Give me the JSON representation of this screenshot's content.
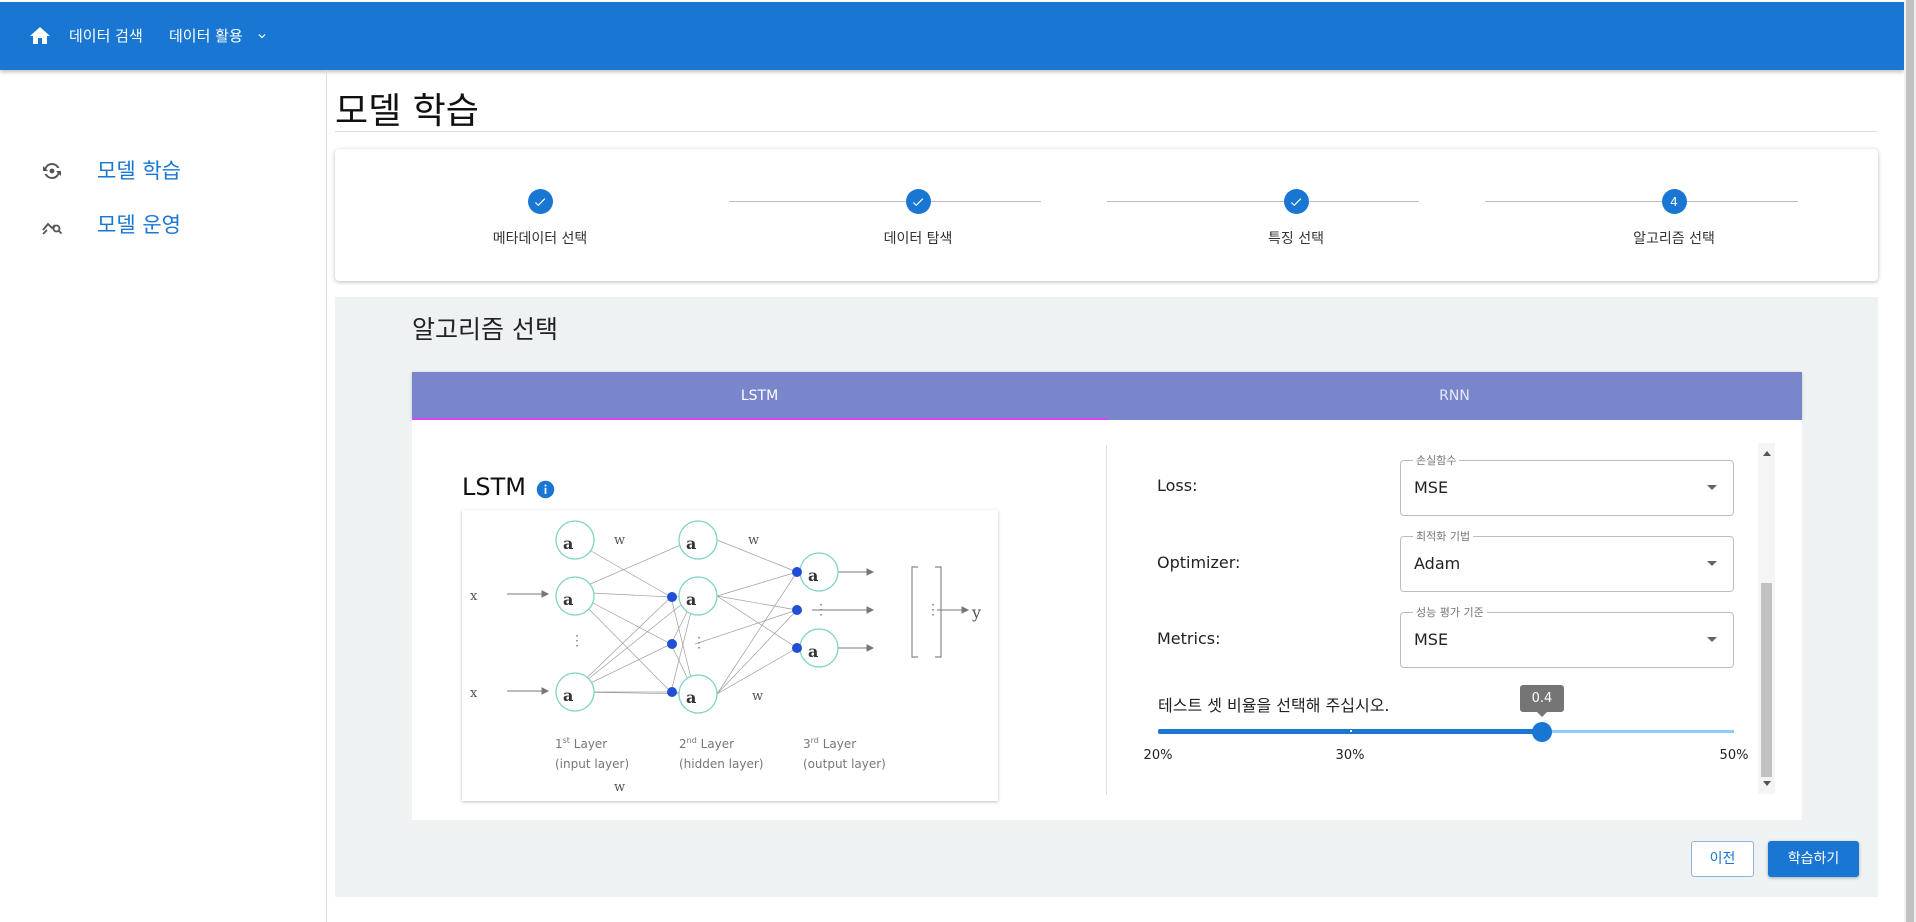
{
  "header": {
    "nav_search": "데이터 검색",
    "nav_use": "데이터 활용",
    "home_icon": "home-icon",
    "dropdown_icon": "chevron-down-icon",
    "color": "#1976d2"
  },
  "sidebar": {
    "items": [
      {
        "label": "모델 학습",
        "icon": "model-training-icon"
      },
      {
        "label": "모델 운영",
        "icon": "query-stats-icon"
      }
    ]
  },
  "page": {
    "title": "모델 학습"
  },
  "stepper": {
    "steps": [
      {
        "label": "메타데이터 선택",
        "state": "completed"
      },
      {
        "label": "데이터 탐색",
        "state": "completed"
      },
      {
        "label": "특징 선택",
        "state": "completed"
      },
      {
        "label": "알고리즘 선택",
        "state": "active",
        "number": "4"
      }
    ]
  },
  "algorithm": {
    "heading": "알고리즘 선택",
    "tabs": [
      {
        "label": "LSTM",
        "selected": true
      },
      {
        "label": "RNN",
        "selected": false
      }
    ],
    "tab_color": "#7986cb",
    "indicator_color": "#e040fb",
    "model_title": "LSTM",
    "info_icon": "info-icon",
    "diagram": {
      "inputs": [
        "x",
        "x"
      ],
      "layer_labels": [
        "1",
        "Layer",
        "(input layer)",
        "2",
        "Layer",
        "(hidden layer)",
        "3",
        "Layer",
        "(output layer)"
      ],
      "layer_ord": [
        "st",
        "nd",
        "rd"
      ],
      "output": "y"
    }
  },
  "params": {
    "loss": {
      "label": "Loss:",
      "legend": "손실함수",
      "value": "MSE"
    },
    "optimizer": {
      "label": "Optimizer:",
      "legend": "최적화 기법",
      "value": "Adam"
    },
    "metrics": {
      "label": "Metrics:",
      "legend": "성능 평가 기준",
      "value": "MSE"
    }
  },
  "slider": {
    "label": "테스트 셋 비율을 선택해 주십시오.",
    "value": 0.4,
    "value_label": "0.4",
    "min": 0.2,
    "max": 0.5,
    "tick_labels": [
      {
        "value": 0.2,
        "label": "20%"
      },
      {
        "value": 0.3,
        "label": "30%"
      },
      {
        "value": 0.5,
        "label": "50%"
      }
    ]
  },
  "actions": {
    "prev": "이전",
    "train": "학습하기"
  }
}
